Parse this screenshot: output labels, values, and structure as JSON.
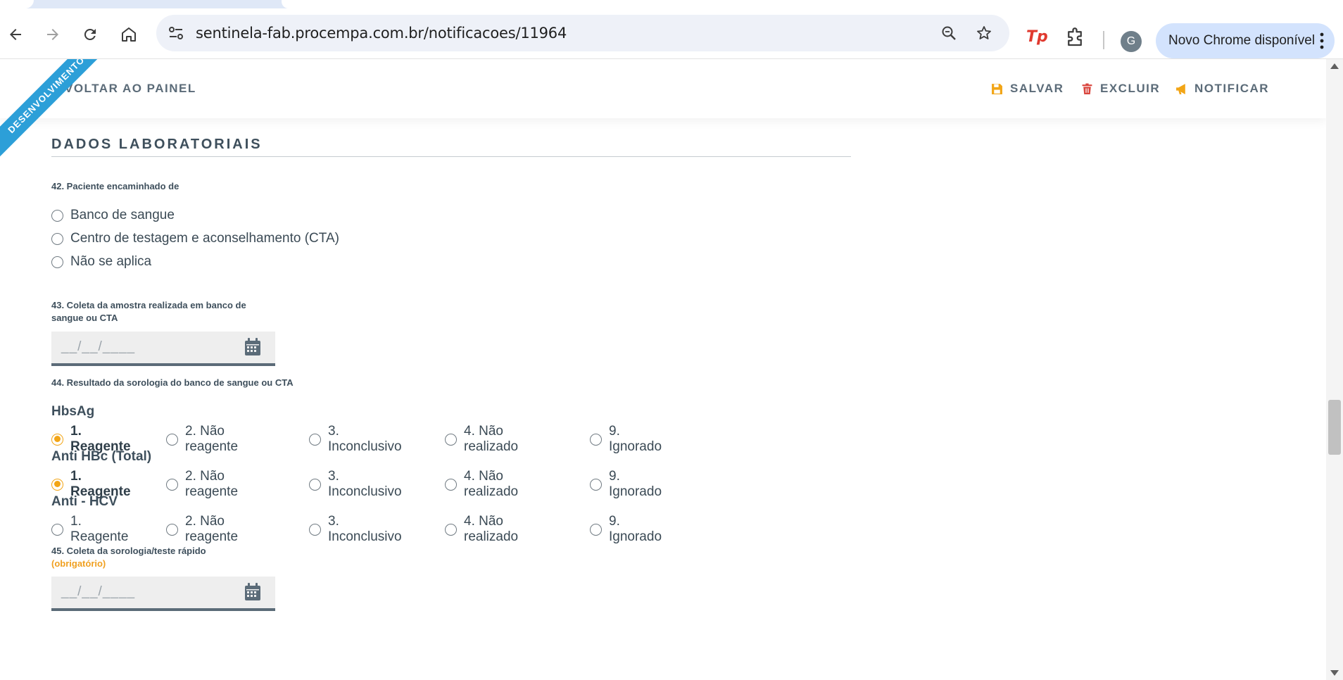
{
  "browser": {
    "url": "sentinela-fab.procempa.com.br/notificacoes/11964",
    "avatar_initial": "G",
    "update_chip": "Novo Chrome disponível",
    "ext_tp_label": "Tp"
  },
  "header": {
    "back_label": "VOLTAR AO PAINEL",
    "save_label": "SALVAR",
    "delete_label": "EXCLUIR",
    "notify_label": "NOTIFICAR",
    "ribbon_label": "DESENVOLVIMENTO",
    "save_color": "#f2a516",
    "delete_color": "#d9453d",
    "notify_color": "#f2a516"
  },
  "section": {
    "title": "DADOS LABORATORIAIS"
  },
  "q42": {
    "label": "42. Paciente encaminhado de",
    "options": [
      "Banco de sangue",
      "Centro de testagem e aconselhamento (CTA)",
      "Não se aplica"
    ]
  },
  "q43": {
    "label_line1": "43. Coleta da amostra realizada em banco de",
    "label_line2": "sangue ou CTA",
    "date_mask": "__/__/____"
  },
  "q44": {
    "label": "44. Resultado da sorologia do banco de sangue ou CTA",
    "options": [
      "1. Reagente",
      "2. Não reagente",
      "3. Inconclusivo",
      "4. Não realizado",
      "9. Ignorado"
    ],
    "tests": [
      {
        "name": "HbsAg",
        "selected": 0
      },
      {
        "name": "Anti HBc (Total)",
        "selected": 0
      },
      {
        "name": "Anti - HCV",
        "selected": -1
      }
    ]
  },
  "q45": {
    "label": "45. Coleta da sorologia/teste rápido",
    "required": "(obrigatório)",
    "date_mask": "__/__/____"
  },
  "colors": {
    "accent": "#f2a516",
    "ribbon": "#2c9fd8",
    "text": "#3e4f5c",
    "field_bg": "#eeeeee"
  }
}
